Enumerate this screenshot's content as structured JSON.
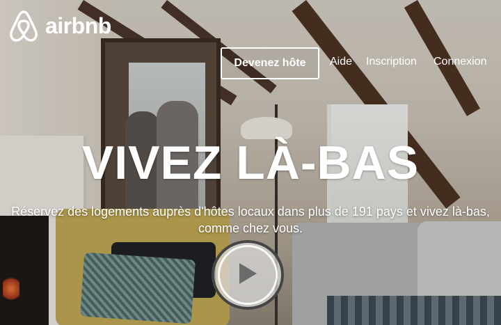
{
  "brand": {
    "name": "airbnb",
    "logo_icon": "airbnb-belo-icon",
    "color": "#ffffff"
  },
  "nav": {
    "host_button": "Devenez hôte",
    "links": [
      "Aide",
      "Inscription",
      "Connexion"
    ]
  },
  "hero": {
    "headline": "VIVEZ LÀ-BAS",
    "subheadline": "Réservez des logements auprès d'hôtes locaux dans plus de 191 pays et vivez là-bas, comme chez vous.",
    "play_icon": "play-icon"
  }
}
